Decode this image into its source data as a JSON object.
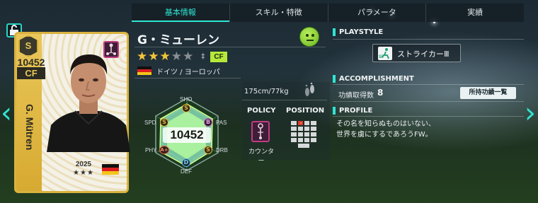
{
  "tabs": [
    {
      "label": "基本情報",
      "active": true
    },
    {
      "label": "スキル・特徴",
      "active": false
    },
    {
      "label": "パラメータ",
      "active": false
    },
    {
      "label": "実績",
      "active": false
    }
  ],
  "card": {
    "rank_letter": "S",
    "overall": "10452",
    "position": "CF",
    "name": "G. Mütren",
    "year": "2025",
    "stars": "★★★",
    "flag": "germany-flag-icon"
  },
  "player": {
    "name": "G・ミューレン",
    "rarity_stars_filled": 3,
    "rarity_stars_total": 5,
    "position_tag": "CF",
    "nationality": "ドイツ / ヨーロッパ",
    "height_weight": "175cm/77kg",
    "condition_icon": "neutral-face-icon"
  },
  "radar": {
    "total": "10452",
    "axes": [
      {
        "label": "SHO",
        "grade": "S"
      },
      {
        "label": "PAS",
        "grade": "B"
      },
      {
        "label": "DRB",
        "grade": "S"
      },
      {
        "label": "DEF",
        "grade": "D"
      },
      {
        "label": "PHY",
        "grade": "A+"
      },
      {
        "label": "SPD",
        "grade": "S"
      }
    ]
  },
  "policy": {
    "header": "POLICY",
    "value": "カウンター"
  },
  "position_section": {
    "header": "POSITION"
  },
  "playstyle": {
    "header": "PLAYSTYLE",
    "icon_text": "ST",
    "value": "ストライカーⅢ"
  },
  "accomplishment": {
    "header": "ACCOMPLISHMENT",
    "label": "功績取得数",
    "count": "8",
    "button": "所持功績一覧"
  },
  "profile": {
    "header": "PROFILE",
    "lines": [
      "その名を知らぬものはいない、",
      "世界を虜にするであろうFW。"
    ]
  },
  "colors": {
    "accent": "#2ee6d3",
    "card_gold": "#d9b23f",
    "position_green": "#b6e83b",
    "policy_pink": "#c23b86"
  }
}
